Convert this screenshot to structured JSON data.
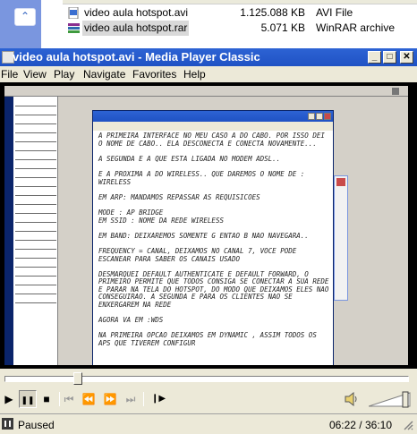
{
  "explorer": {
    "files": [
      {
        "name": "video aula hotspot.avi",
        "size": "1.125.088 KB",
        "type": "AVI File",
        "icon": "avi-file-icon"
      },
      {
        "name": "video aula hotspot.rar",
        "size": "5.071 KB",
        "type": "WinRAR archive",
        "icon": "winrar-archive-icon"
      }
    ],
    "collapse_icon": "chevron-up-icon"
  },
  "window": {
    "title": "video aula hotspot.avi - Media Player Classic",
    "caption_buttons": {
      "minimize": "_",
      "maximize": "□",
      "close": "✕"
    }
  },
  "menu": {
    "items": [
      "File",
      "View",
      "Play",
      "Navigate",
      "Favorites",
      "Help"
    ]
  },
  "video_frame": {
    "notepad_paragraphs": [
      "A PRIMEIRA INTERFACE NO MEU CASO A DO CABO. POR ISSO DEI O NOME DE CABO.. ELA DESCONECTA E CONECTA NOVAMENTE...",
      "A SEGUNDA E A QUE ESTA LIGADA NO MODEM ADSL..",
      "E A PROXIMA A DO WIRELESS.. QUE DAREMOS O NOME DE : WIRELESS",
      "EM ARP: MANDAMOS REPASSAR AS REQUISICOES",
      "MODE : AP BRIDGE\nEM SSID : NOME DA REDE WIRELESS",
      "EM BAND: DEIXAREMOS SOMENTE G ENTAO B NAO NAVEGARA..",
      "FREQUENCY = CANAL, DEIXAMOS NO CANAL 7, VOCE PODE ESCANEAR PARA SABER OS CANAIS USADO",
      "DESMARQUEI DEFAULT AUTHENTICATE E DEFAULT FORWARD, O PRIMEIRO PERMITE QUE TODOS CONSIGA SE CONECTAR A SUA REDE E PARAR NA TELA DO HOTSPOT, DO MODO QUE DEIXAMOS ELES NAO CONSEGUIRAO. A SEGUNDA E PARA OS CLIENTES NAO SE ENXERGAREM NA REDE",
      "AGORA VA EM :WDS",
      "NA PRIMEIRA OPCAO DEIXAMOS EM DYNAMIC , ASSIM TODOS OS APS QUE TIVEREM CONFIGUR"
    ]
  },
  "player": {
    "seek_position": 0.175,
    "volume_level": 0.95,
    "buttons": [
      {
        "name": "play-icon",
        "glyph": "▶",
        "dim": false
      },
      {
        "name": "pause-icon",
        "glyph": "❚❚",
        "dim": false
      },
      {
        "name": "stop-icon",
        "glyph": "■",
        "dim": false
      },
      {
        "name": "previous-icon",
        "glyph": "⏮",
        "dim": true
      },
      {
        "name": "rewind-icon",
        "glyph": "⏪",
        "dim": false
      },
      {
        "name": "fast-forward-icon",
        "glyph": "⏩",
        "dim": false
      },
      {
        "name": "next-icon",
        "glyph": "⏭",
        "dim": true
      },
      {
        "name": "frame-step-icon",
        "glyph": "❙▶",
        "dim": false
      }
    ]
  },
  "status": {
    "state": "Paused",
    "time": "06:22 / 36:10"
  }
}
